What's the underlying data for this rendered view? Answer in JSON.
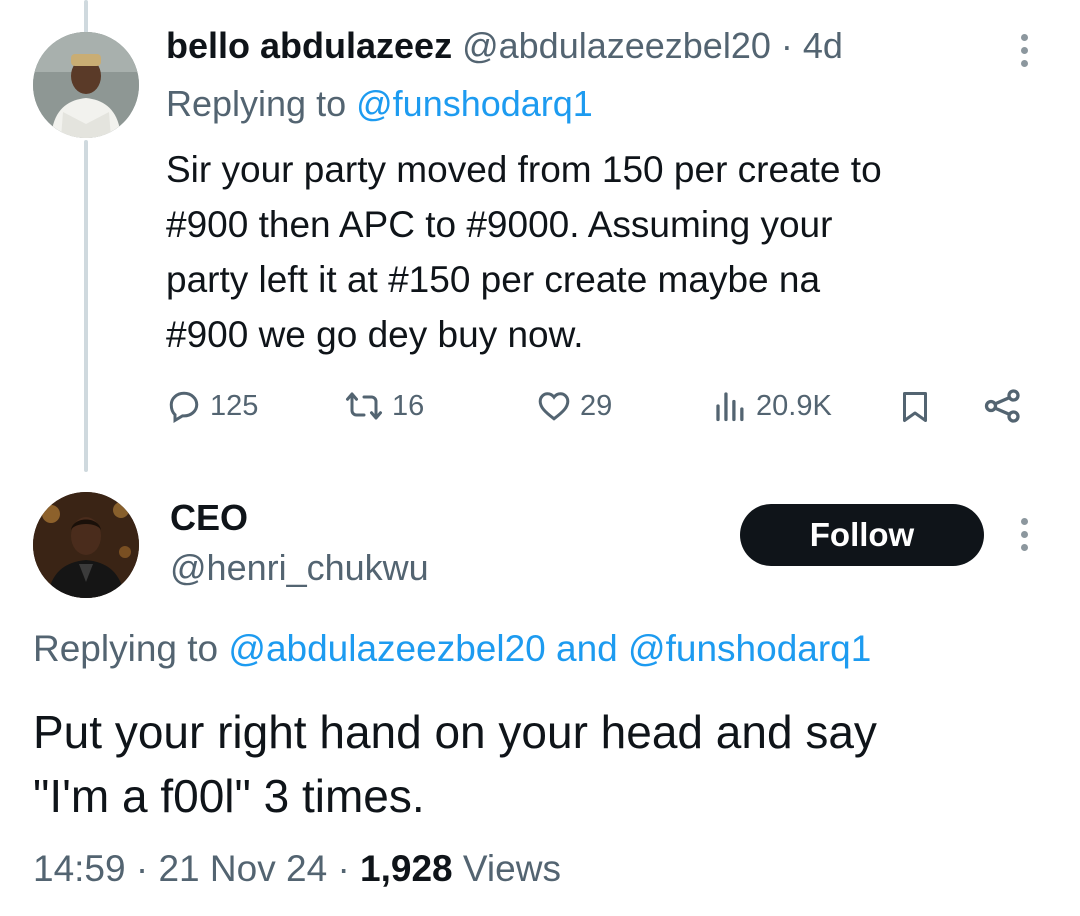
{
  "reply_tweet": {
    "display_name": "bello abdulazeez",
    "handle": "@abdulazeezbel20",
    "separator": "·",
    "age": "4d",
    "replying_label": "Replying to",
    "replying_to": "@funshodarq1",
    "body_lines": [
      "Sir your party moved from 150 per create to",
      "#900 then APC to #9000. Assuming your",
      "party left it at #150 per create maybe na",
      "#900 we go dey buy now."
    ],
    "actions": {
      "replies": "125",
      "retweets": "16",
      "likes": "29",
      "views": "20.9K"
    }
  },
  "main_tweet": {
    "display_name": "CEO",
    "handle": "@henri_chukwu",
    "follow_label": "Follow",
    "replying_label": "Replying to",
    "replying_to_1": "@abdulazeezbel20",
    "and_label": "and",
    "replying_to_2": "@funshodarq1",
    "text_lines": [
      "Put your right hand on your head and say",
      "\"I'm a f00l\" 3 times."
    ],
    "time": "14:59",
    "date": "21 Nov 24",
    "separator": "·",
    "view_count": "1,928",
    "views_label": "Views"
  },
  "colors": {
    "link": "#1d9bf0",
    "muted": "#536471",
    "text": "#0f1419",
    "follow_bg": "#0f1419"
  },
  "icons": [
    "reply-icon",
    "retweet-icon",
    "like-icon",
    "views-icon",
    "bookmark-icon",
    "share-icon",
    "more-icon"
  ]
}
